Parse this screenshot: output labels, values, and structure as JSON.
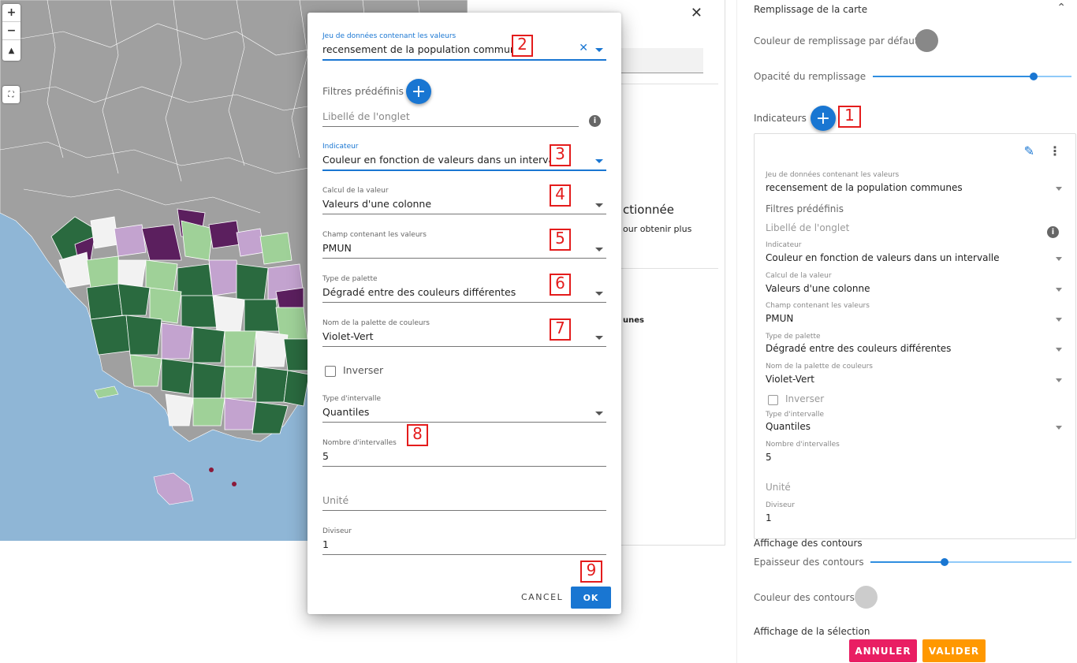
{
  "map": {
    "zoom_in": "+",
    "zoom_out": "−",
    "reset_north": "▲",
    "fullscreen": "⛶",
    "colors": {
      "sea": "#8fb6d6",
      "land": "#a0a0a0",
      "purple_dark": "#5b1f5e",
      "purple_light": "#c3a3cf",
      "green_light": "#9fd198",
      "green_dark": "#2a6a3f",
      "white": "#f2f2f2"
    }
  },
  "middle": {
    "close": "✕",
    "heading_fragment": "ctionnée",
    "text_fragment": "our obtenir plus",
    "list_fragment": "unes"
  },
  "right": {
    "section_fill": "Remplissage de la carte",
    "default_fill_color_label": "Couleur de remplissage par défaut",
    "fill_opacity_label": "Opacité du remplissage",
    "indicators_label": "Indicateurs",
    "indicators_add": "+",
    "card": {
      "dataset_label": "Jeu de données contenant les valeurs",
      "dataset_value": "recensement de la population communes",
      "filters_label": "Filtres prédéfinis",
      "tab_label_placeholder": "Libellé de l'onglet",
      "indicator_label": "Indicateur",
      "indicator_value": "Couleur en fonction de valeurs dans un intervalle",
      "calc_label": "Calcul de la valeur",
      "calc_value": "Valeurs d'une colonne",
      "field_label": "Champ contenant les valeurs",
      "field_value": "PMUN",
      "palette_type_label": "Type de palette",
      "palette_type_value": "Dégradé entre des couleurs différentes",
      "palette_name_label": "Nom de la palette de couleurs",
      "palette_name_value": "Violet-Vert",
      "invert_label": "Inverser",
      "interval_type_label": "Type d'intervalle",
      "interval_type_value": "Quantiles",
      "interval_count_label": "Nombre d'intervalles",
      "interval_count_value": "5",
      "unit_placeholder": "Unité",
      "divisor_label": "Diviseur",
      "divisor_value": "1"
    },
    "contours_label": "Affichage des contours",
    "contour_width_label": "Epaisseur des contours",
    "contour_color_label": "Couleur des contours",
    "selection_label": "Affichage de la sélection",
    "cancel_button": "ANNULER",
    "validate_button": "VALIDER",
    "colors": {
      "cancel": "#e91e63",
      "validate": "#ff9800",
      "default_fill": "#888888",
      "contour_color": "#cccccc"
    },
    "sliders": {
      "opacity": 0.81,
      "contour_width": 0.37
    }
  },
  "dialog": {
    "dataset_label": "Jeu de données contenant les valeurs",
    "dataset_value": "recensement de la population communes",
    "clear_icon": "✕",
    "filters_label": "Filtres prédéfinis",
    "filters_add": "+",
    "tab_label_placeholder": "Libellé de l'onglet",
    "info_icon": "i",
    "indicator_label": "Indicateur",
    "indicator_value": "Couleur en fonction de valeurs dans un intervalle",
    "calc_label": "Calcul de la valeur",
    "calc_value": "Valeurs d'une colonne",
    "field_label": "Champ contenant les valeurs",
    "field_value": "PMUN",
    "palette_type_label": "Type de palette",
    "palette_type_value": "Dégradé entre des couleurs différentes",
    "palette_name_label": "Nom de la palette de couleurs",
    "palette_name_value": "Violet-Vert",
    "invert_label": "Inverser",
    "interval_type_label": "Type d'intervalle",
    "interval_type_value": "Quantiles",
    "interval_count_label": "Nombre d'intervalles",
    "interval_count_value": "5",
    "unit_placeholder": "Unité",
    "divisor_label": "Diviseur",
    "divisor_value": "1",
    "cancel_button": "CANCEL",
    "ok_button": "OK"
  },
  "markers": [
    "1",
    "2",
    "3",
    "4",
    "5",
    "6",
    "7",
    "8",
    "9"
  ]
}
